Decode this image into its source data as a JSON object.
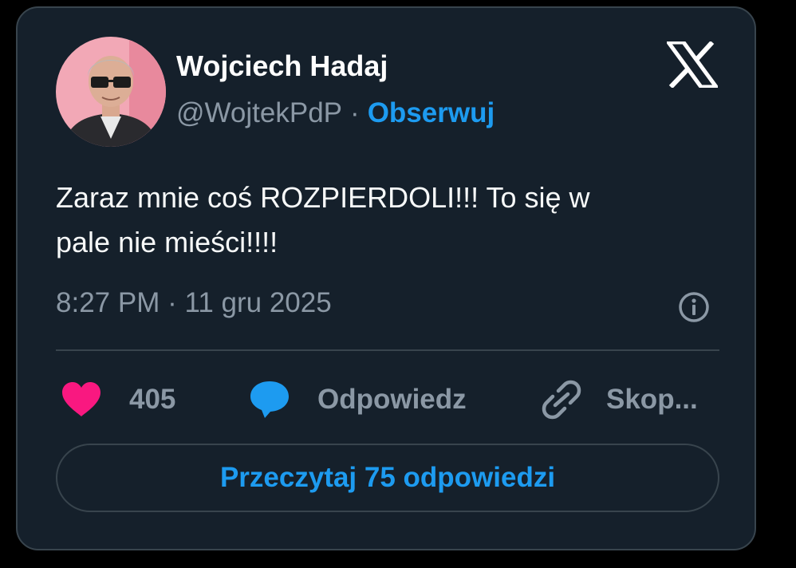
{
  "author": {
    "name": "Wojciech Hadaj",
    "handle": "@WojtekPdP",
    "separator": "·",
    "follow_label": "Obserwuj"
  },
  "tweet": {
    "text_line1": "Zaraz mnie coś ROZPIERDOLI!!! To się w",
    "text_line2": "pale nie mieści!!!!",
    "timestamp": "8:27 PM · 11 gru 2025"
  },
  "actions": {
    "like_count": "405",
    "reply_label": "Odpowiedz",
    "copy_label": "Skop..."
  },
  "read_replies_label": "Przeczytaj 75 odpowiedzi",
  "icons": {
    "logo": "x-logo-icon",
    "info": "info-icon",
    "like": "heart-icon",
    "reply": "speech-bubble-icon",
    "copy": "link-icon"
  },
  "colors": {
    "card_background": "#15202b",
    "border": "#38444d",
    "accent": "#1d9bf0",
    "like": "#f91880",
    "secondary_text": "#8b98a5",
    "primary_text": "#f7f9f9"
  }
}
